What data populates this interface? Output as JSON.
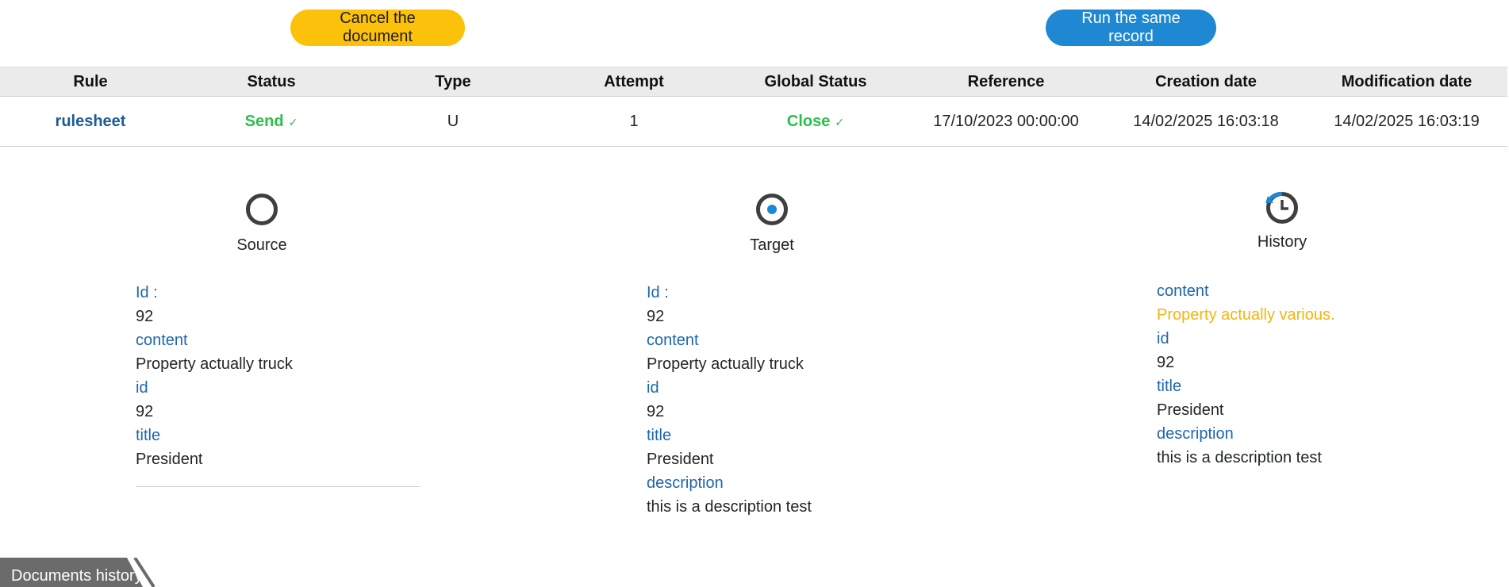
{
  "actions": {
    "cancel_label": "Cancel the document",
    "run_label": "Run the same record"
  },
  "table": {
    "headers": [
      "Rule",
      "Status",
      "Type",
      "Attempt",
      "Global Status",
      "Reference",
      "Creation date",
      "Modification date"
    ],
    "row": {
      "rule": "rulesheet",
      "status": "Send",
      "type": "U",
      "attempt": "1",
      "global_status": "Close",
      "reference": "17/10/2023 00:00:00",
      "creation_date": "14/02/2025 16:03:18",
      "modification_date": "14/02/2025 16:03:19"
    },
    "check_glyph": "✓"
  },
  "source": {
    "title": "Source",
    "icon": "ring-icon",
    "fields": [
      {
        "label": "Id :",
        "value": "92"
      },
      {
        "label": "content",
        "value": "Property actually truck"
      },
      {
        "label": "id",
        "value": "92"
      },
      {
        "label": "title",
        "value": "President"
      }
    ]
  },
  "target": {
    "title": "Target",
    "icon": "target-icon",
    "fields": [
      {
        "label": "Id :",
        "value": "92"
      },
      {
        "label": "content",
        "value": "Property actually truck"
      },
      {
        "label": "id",
        "value": "92"
      },
      {
        "label": "title",
        "value": "President"
      },
      {
        "label": "description",
        "value": "this is a description test"
      }
    ]
  },
  "history": {
    "title": "History",
    "icon": "history-clock-icon",
    "fields": [
      {
        "label": "content",
        "value": "Property actually various."
      },
      {
        "label": "id",
        "value": "92"
      },
      {
        "label": "title",
        "value": "President"
      },
      {
        "label": "description",
        "value": "this is a description test"
      }
    ]
  },
  "bottom_tab": {
    "label": "Documents history"
  },
  "colors": {
    "cancel_button": "#fcc10a",
    "run_button": "#1e88d2",
    "label_blue": "#1d66b0",
    "status_green": "#2bbf4a",
    "changed_value": "#f5b40f"
  }
}
